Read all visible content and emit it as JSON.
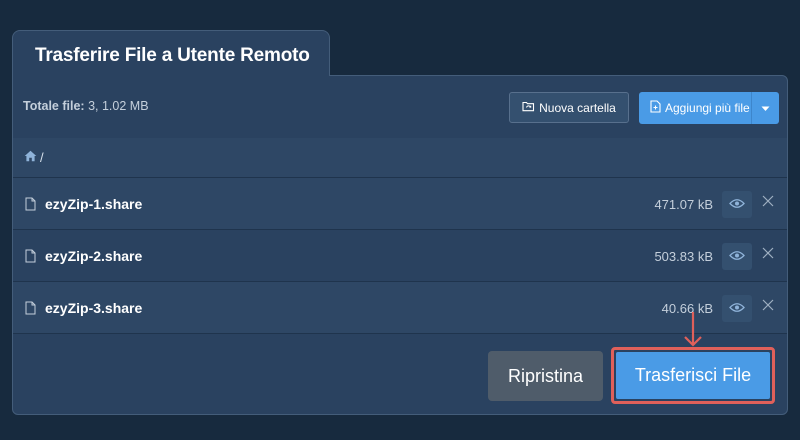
{
  "dialog": {
    "title": "Trasferire File a Utente Remoto"
  },
  "toolbar": {
    "total_label": "Totale file:",
    "total_value": "3, 1.02 MB",
    "new_folder_label": "Nuova cartella",
    "new_folder_icon": "folder-sync-icon",
    "add_files_label": "Aggiungi più file",
    "add_files_icon": "add-file-icon",
    "add_files_caret_icon": "caret-down-icon"
  },
  "breadcrumb": {
    "home_icon": "home-icon",
    "path": "/"
  },
  "files": [
    {
      "name": "ezyZip-1.share",
      "size": "471.07 kB"
    },
    {
      "name": "ezyZip-2.share",
      "size": "503.83 kB"
    },
    {
      "name": "ezyZip-3.share",
      "size": "40.66 kB"
    }
  ],
  "actions": {
    "reset_label": "Ripristina",
    "transfer_label": "Trasferisci File"
  },
  "colors": {
    "background": "#172a3e",
    "panel": "#2a4260",
    "accent": "#4a9be6",
    "highlight": "#e0605a",
    "reset_button": "#4f5c6a"
  }
}
